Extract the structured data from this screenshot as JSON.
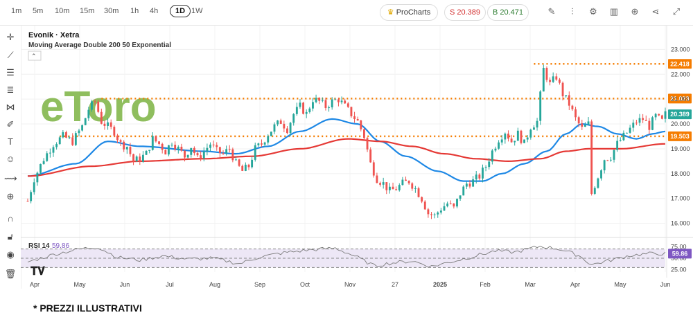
{
  "toolbar": {
    "timeframes": [
      "1m",
      "5m",
      "10m",
      "15m",
      "30m",
      "1h",
      "4h",
      "1D",
      "1W"
    ],
    "active_timeframe": "1D",
    "procharts_label": "ProCharts",
    "sell_label": "S 20.389",
    "buy_label": "B 20.471",
    "icons": [
      "pencil-icon",
      "candles-icon",
      "gear-icon",
      "bars-icon",
      "add-icon",
      "share-icon",
      "fullscreen-icon"
    ]
  },
  "sidebar": {
    "icons": [
      "crosshair-icon",
      "trendline-icon",
      "horizontal-lines-icon",
      "fib-icon",
      "pattern-icon",
      "brush-icon",
      "text-icon",
      "emoji-icon",
      "ruler-icon",
      "zoom-in-icon",
      "magnet-icon",
      "lock-icon",
      "eye-icon",
      "trash-icon"
    ]
  },
  "legend": {
    "symbol": "Evonik · Xetra",
    "indicator": "Moving Average Double 200 50 Exponential"
  },
  "watermark": "eToro",
  "rsi_label": "RSI 14",
  "rsi_value": "59.86",
  "footer_note": "* PREZZI ILLUSTRATIVI",
  "colors": {
    "up": "#26a69a",
    "down": "#ef5350",
    "ema50": "#1e88e5",
    "ema200": "#e53935",
    "level": "#f57c00",
    "rsi": "#7a7a7a",
    "rsi_band": "#ede7f6",
    "watermark": "#7cb342"
  },
  "chart_data": [
    {
      "type": "candlestick",
      "title": "Evonik · Xetra",
      "x_ticks": [
        "Apr",
        "May",
        "Jun",
        "Jul",
        "Aug",
        "Sep",
        "Oct",
        "Nov",
        "27",
        "2025",
        "Feb",
        "Mar",
        "Apr",
        "May",
        "Jun"
      ],
      "y_ticks": [
        "16.000",
        "17.000",
        "18.000",
        "19.000",
        "20.000",
        "21.000",
        "22.000",
        "23.000"
      ],
      "ylim": [
        15.6,
        23.4
      ],
      "last_price": 20.389,
      "price_path": [
        [
          0,
          16.9
        ],
        [
          2,
          17.8
        ],
        [
          5,
          18.6
        ],
        [
          8,
          19.2
        ],
        [
          11,
          19.5
        ],
        [
          14,
          19.3
        ],
        [
          17,
          19.9
        ],
        [
          19,
          20.6
        ],
        [
          21,
          20.9
        ],
        [
          23,
          20.1
        ],
        [
          25,
          19.9
        ],
        [
          27,
          19.7
        ],
        [
          29,
          19.2
        ],
        [
          31,
          19.1
        ],
        [
          33,
          18.5
        ],
        [
          35,
          18.6
        ],
        [
          37,
          18.8
        ],
        [
          39,
          19.4
        ],
        [
          41,
          19.2
        ],
        [
          43,
          18.9
        ],
        [
          45,
          19.3
        ],
        [
          47,
          19.0
        ],
        [
          49,
          18.7
        ],
        [
          51,
          19.1
        ],
        [
          53,
          18.6
        ],
        [
          55,
          18.9
        ],
        [
          57,
          19.2
        ],
        [
          59,
          18.9
        ],
        [
          61,
          18.8
        ],
        [
          63,
          19.0
        ],
        [
          65,
          18.4
        ],
        [
          67,
          18.1
        ],
        [
          69,
          18.3
        ],
        [
          71,
          19.0
        ],
        [
          73,
          19.2
        ],
        [
          75,
          19.6
        ],
        [
          77,
          19.9
        ],
        [
          79,
          20.1
        ],
        [
          81,
          19.8
        ],
        [
          83,
          20.4
        ],
        [
          85,
          20.7
        ],
        [
          87,
          20.4
        ],
        [
          89,
          21.0
        ],
        [
          91,
          20.9
        ],
        [
          93,
          20.7
        ],
        [
          95,
          20.9
        ],
        [
          97,
          21.0
        ],
        [
          99,
          20.7
        ],
        [
          101,
          20.4
        ],
        [
          103,
          20.1
        ],
        [
          105,
          19.5
        ],
        [
          107,
          18.4
        ],
        [
          109,
          17.8
        ],
        [
          111,
          17.6
        ],
        [
          113,
          17.3
        ],
        [
          115,
          17.4
        ],
        [
          117,
          17.6
        ],
        [
          119,
          17.7
        ],
        [
          121,
          17.4
        ],
        [
          123,
          17.0
        ],
        [
          125,
          16.4
        ],
        [
          127,
          16.3
        ],
        [
          129,
          16.6
        ],
        [
          131,
          16.8
        ],
        [
          133,
          16.6
        ],
        [
          135,
          17.2
        ],
        [
          137,
          17.6
        ],
        [
          139,
          17.7
        ],
        [
          141,
          17.9
        ],
        [
          143,
          18.3
        ],
        [
          145,
          18.9
        ],
        [
          147,
          19.4
        ],
        [
          149,
          19.7
        ],
        [
          151,
          19.3
        ],
        [
          153,
          19.6
        ],
        [
          155,
          19.2
        ],
        [
          157,
          19.9
        ],
        [
          159,
          20.1
        ],
        [
          161,
          22.2
        ],
        [
          163,
          21.6
        ],
        [
          165,
          21.9
        ],
        [
          167,
          21.2
        ],
        [
          169,
          20.8
        ],
        [
          171,
          20.2
        ],
        [
          173,
          19.8
        ],
        [
          175,
          20.0
        ],
        [
          176,
          17.2
        ],
        [
          178,
          17.9
        ],
        [
          180,
          18.6
        ],
        [
          182,
          18.7
        ],
        [
          184,
          19.2
        ],
        [
          186,
          19.5
        ],
        [
          188,
          19.8
        ],
        [
          190,
          20.1
        ],
        [
          192,
          20.2
        ],
        [
          194,
          19.9
        ],
        [
          196,
          20.3
        ],
        [
          198,
          20.1
        ],
        [
          199,
          20.39
        ]
      ],
      "series": [
        {
          "name": "EMA 50",
          "points": [
            [
              0,
              17.9
            ],
            [
              15,
              18.4
            ],
            [
              25,
              19.3
            ],
            [
              35,
              19.1
            ],
            [
              55,
              18.9
            ],
            [
              65,
              18.8
            ],
            [
              75,
              19.1
            ],
            [
              85,
              19.7
            ],
            [
              95,
              20.2
            ],
            [
              103,
              20.0
            ],
            [
              110,
              19.3
            ],
            [
              118,
              18.7
            ],
            [
              128,
              18.1
            ],
            [
              136,
              17.7
            ],
            [
              142,
              17.7
            ],
            [
              148,
              18.0
            ],
            [
              155,
              18.4
            ],
            [
              162,
              18.9
            ],
            [
              168,
              19.6
            ],
            [
              173,
              20.0
            ],
            [
              178,
              19.9
            ],
            [
              184,
              19.6
            ],
            [
              190,
              19.4
            ],
            [
              195,
              19.6
            ],
            [
              199,
              19.7
            ]
          ]
        },
        {
          "name": "EMA 200",
          "points": [
            [
              0,
              17.9
            ],
            [
              20,
              18.3
            ],
            [
              35,
              18.5
            ],
            [
              55,
              18.6
            ],
            [
              70,
              18.7
            ],
            [
              85,
              19.0
            ],
            [
              100,
              19.4
            ],
            [
              110,
              19.3
            ],
            [
              120,
              19.1
            ],
            [
              130,
              18.8
            ],
            [
              140,
              18.6
            ],
            [
              150,
              18.5
            ],
            [
              160,
              18.6
            ],
            [
              168,
              18.9
            ],
            [
              175,
              19.0
            ],
            [
              185,
              19.0
            ],
            [
              199,
              19.2
            ]
          ]
        }
      ],
      "levels": [
        {
          "value": 22.418,
          "label": "22.418",
          "start": 158
        },
        {
          "value": 21.023,
          "label": "21.023",
          "start": 23
        },
        {
          "value": 19.503,
          "label": "19.503",
          "start": 10
        }
      ],
      "price_label": "20.389"
    },
    {
      "type": "line",
      "title": "RSI 14",
      "ylim": [
        20,
        80
      ],
      "y_ticks": [
        "75.00",
        "50.00",
        "25.00"
      ],
      "band": [
        30,
        70
      ],
      "value_label": "59.86",
      "points": [
        [
          0,
          42
        ],
        [
          8,
          58
        ],
        [
          16,
          70
        ],
        [
          22,
          74
        ],
        [
          28,
          52
        ],
        [
          35,
          46
        ],
        [
          42,
          55
        ],
        [
          50,
          48
        ],
        [
          58,
          50
        ],
        [
          66,
          38
        ],
        [
          72,
          52
        ],
        [
          80,
          62
        ],
        [
          88,
          68
        ],
        [
          96,
          72
        ],
        [
          102,
          55
        ],
        [
          108,
          34
        ],
        [
          114,
          40
        ],
        [
          120,
          44
        ],
        [
          126,
          32
        ],
        [
          132,
          42
        ],
        [
          138,
          52
        ],
        [
          146,
          66
        ],
        [
          152,
          63
        ],
        [
          160,
          76
        ],
        [
          166,
          70
        ],
        [
          172,
          56
        ],
        [
          176,
          36
        ],
        [
          182,
          46
        ],
        [
          188,
          56
        ],
        [
          194,
          60
        ],
        [
          199,
          60
        ]
      ]
    }
  ]
}
